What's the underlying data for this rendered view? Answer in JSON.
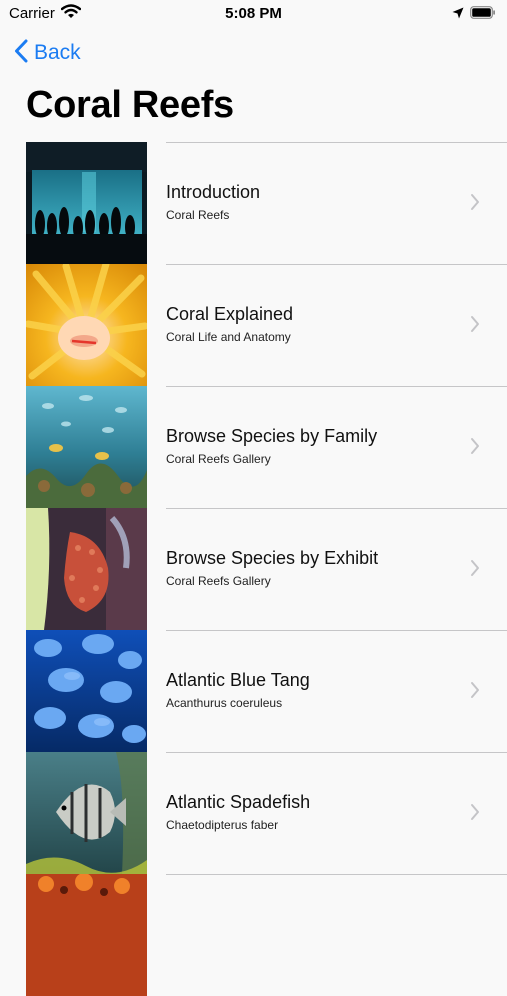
{
  "status_bar": {
    "carrier": "Carrier",
    "time": "5:08 PM"
  },
  "nav": {
    "back_label": "Back"
  },
  "title": "Coral Reefs",
  "items": [
    {
      "title": "Introduction",
      "subtitle": "Coral Reefs"
    },
    {
      "title": "Coral Explained",
      "subtitle": "Coral Life and Anatomy"
    },
    {
      "title": "Browse Species by Family",
      "subtitle": "Coral Reefs Gallery"
    },
    {
      "title": "Browse Species by Exhibit",
      "subtitle": "Coral Reefs Gallery"
    },
    {
      "title": "Atlantic Blue Tang",
      "subtitle": "Acanthurus coeruleus"
    },
    {
      "title": "Atlantic Spadefish",
      "subtitle": "Chaetodipterus faber"
    }
  ],
  "colors": {
    "accent": "#1b7cf2",
    "separator": "#c6c6c8",
    "chevron": "#c4c4c7",
    "background": "#f9f9f9"
  },
  "icons": {
    "back": "chevron-left-icon",
    "disclosure": "chevron-right-icon",
    "wifi": "wifi-icon",
    "location": "location-arrow-icon",
    "battery": "battery-icon"
  }
}
